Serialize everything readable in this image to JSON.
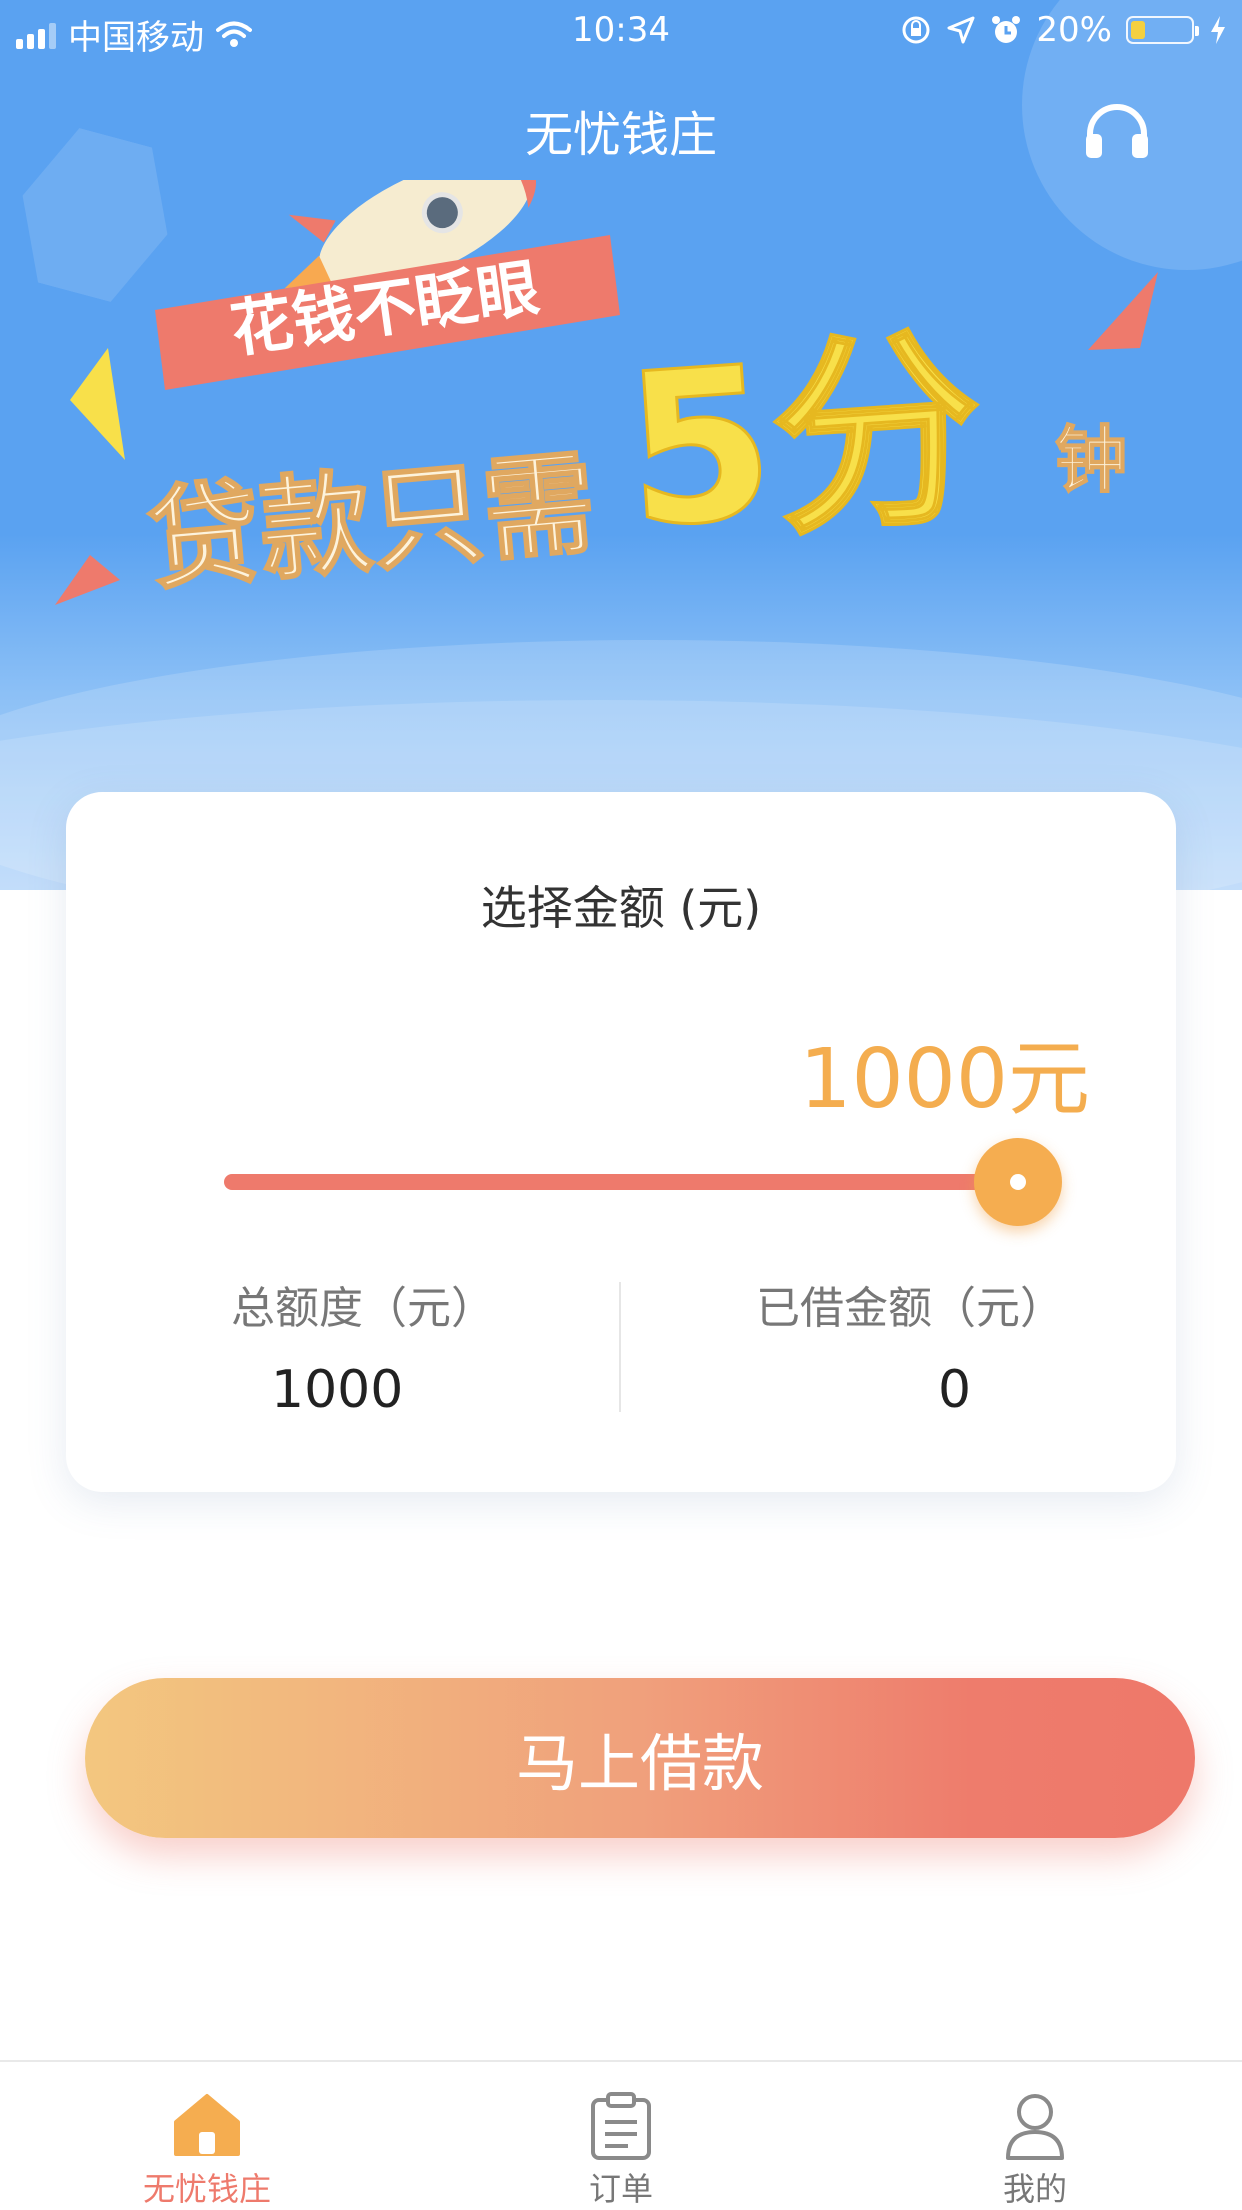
{
  "status_bar": {
    "carrier": "中国移动",
    "time": "10:34",
    "battery": "20%"
  },
  "nav": {
    "title": "无忧钱庄",
    "support_icon": "headset-icon"
  },
  "banner": {
    "tag": "花钱不眨眼",
    "headline_prefix": "贷款只需",
    "headline_number": "5分",
    "headline_suffix": "钟"
  },
  "loan_card": {
    "title": "选择金额 (元)",
    "amount_display": "1000元",
    "slider_value_fraction": 1.0,
    "total_limit_label": "总额度（元）",
    "total_limit_value": "1000",
    "borrowed_label": "已借金额（元）",
    "borrowed_value": "0"
  },
  "cta": {
    "label": "马上借款"
  },
  "tabs": [
    {
      "label": "无忧钱庄",
      "icon": "home-icon",
      "active": true
    },
    {
      "label": "订单",
      "icon": "clipboard-icon",
      "active": false
    },
    {
      "label": "我的",
      "icon": "user-icon",
      "active": false
    }
  ],
  "colors": {
    "primary_blue": "#5aa2f1",
    "accent_orange": "#f4ad4f",
    "accent_red": "#ee7a6c",
    "banner_yellow": "#f8e04a"
  }
}
